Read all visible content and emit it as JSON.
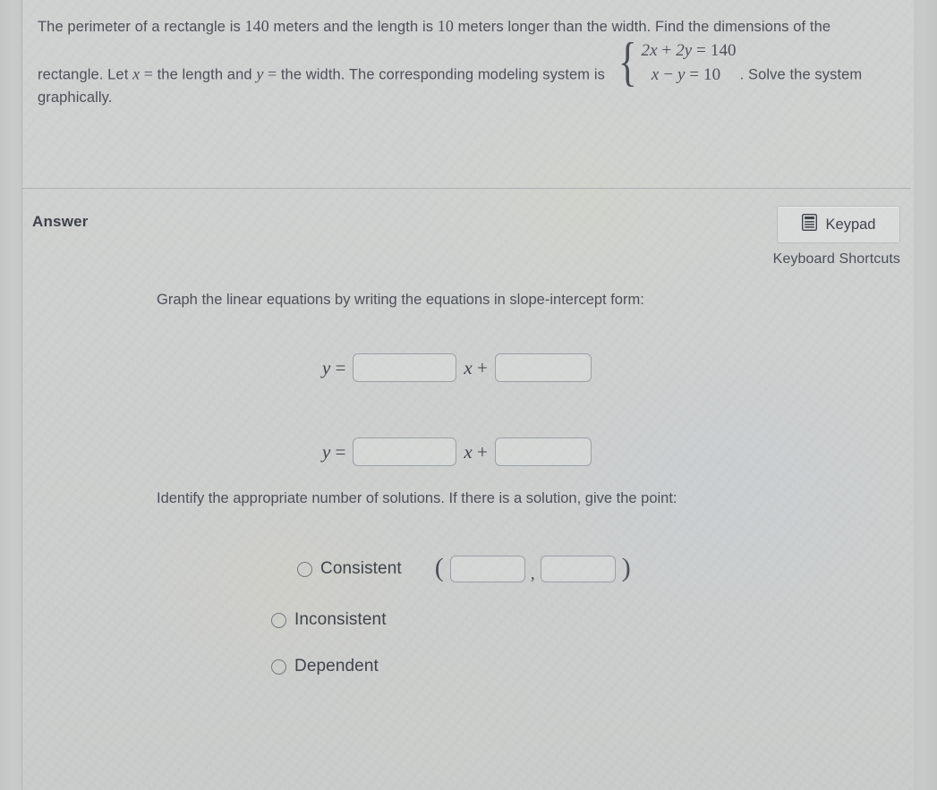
{
  "question": {
    "part1": "The perimeter of a rectangle is ",
    "num_perimeter": "140",
    "part2": " meters and the length is ",
    "num_longer": "10",
    "part3": " meters longer than the width. Find the dimensions of the rectangle. Let ",
    "var_x": "x",
    "eq_sign_1": " = ",
    "part4": " the length and ",
    "var_y": "y",
    "eq_sign_2": " = ",
    "part5": " the width. The corresponding modeling system is ",
    "system": {
      "equation_1": "2x + 2y = 140",
      "equation_2": "x − y = 10",
      "eq1_coef_x": "2x",
      "eq1_plus": " + ",
      "eq1_coef_y": "2y",
      "eq1_equals": " = ",
      "eq1_rhs": "140",
      "eq2_lhs_x": "x",
      "eq2_minus": " − ",
      "eq2_lhs_y": "y",
      "eq2_equals": " = ",
      "eq2_rhs": "10"
    },
    "part6": ". Solve the system graphically."
  },
  "answer_header": {
    "label": "Answer",
    "keypad_label": "Keypad",
    "keypad_icon": "calculator-keypad-icon",
    "keyboard_shortcuts_label": "Keyboard Shortcuts"
  },
  "answer_body": {
    "prompt_slope_intercept": "Graph the linear equations by writing the equations in slope-intercept form:",
    "prompt_solutions": "Identify the appropriate number of solutions. If there is a solution, give the point:",
    "equation_rows": [
      {
        "lead": "y =",
        "mid": "x +",
        "slope_value": "",
        "slope_placeholder": "",
        "intercept_value": "",
        "intercept_placeholder": ""
      },
      {
        "lead": "y =",
        "mid": "x +",
        "slope_value": "",
        "slope_placeholder": "",
        "intercept_value": "",
        "intercept_placeholder": ""
      }
    ],
    "options": [
      {
        "label": "Consistent",
        "selected": false,
        "has_point": true
      },
      {
        "label": "Inconsistent",
        "selected": false,
        "has_point": false
      },
      {
        "label": "Dependent",
        "selected": false,
        "has_point": false
      }
    ],
    "point": {
      "open_paren": "(",
      "comma": ",",
      "close_paren": ")",
      "x_value": "",
      "y_value": ""
    }
  },
  "colors": {
    "text": "#4b5057",
    "heading": "#3d4248",
    "border": "#9aa0a6",
    "panel_bg": "#cfd1d0",
    "divider": "#aeb1b3"
  }
}
